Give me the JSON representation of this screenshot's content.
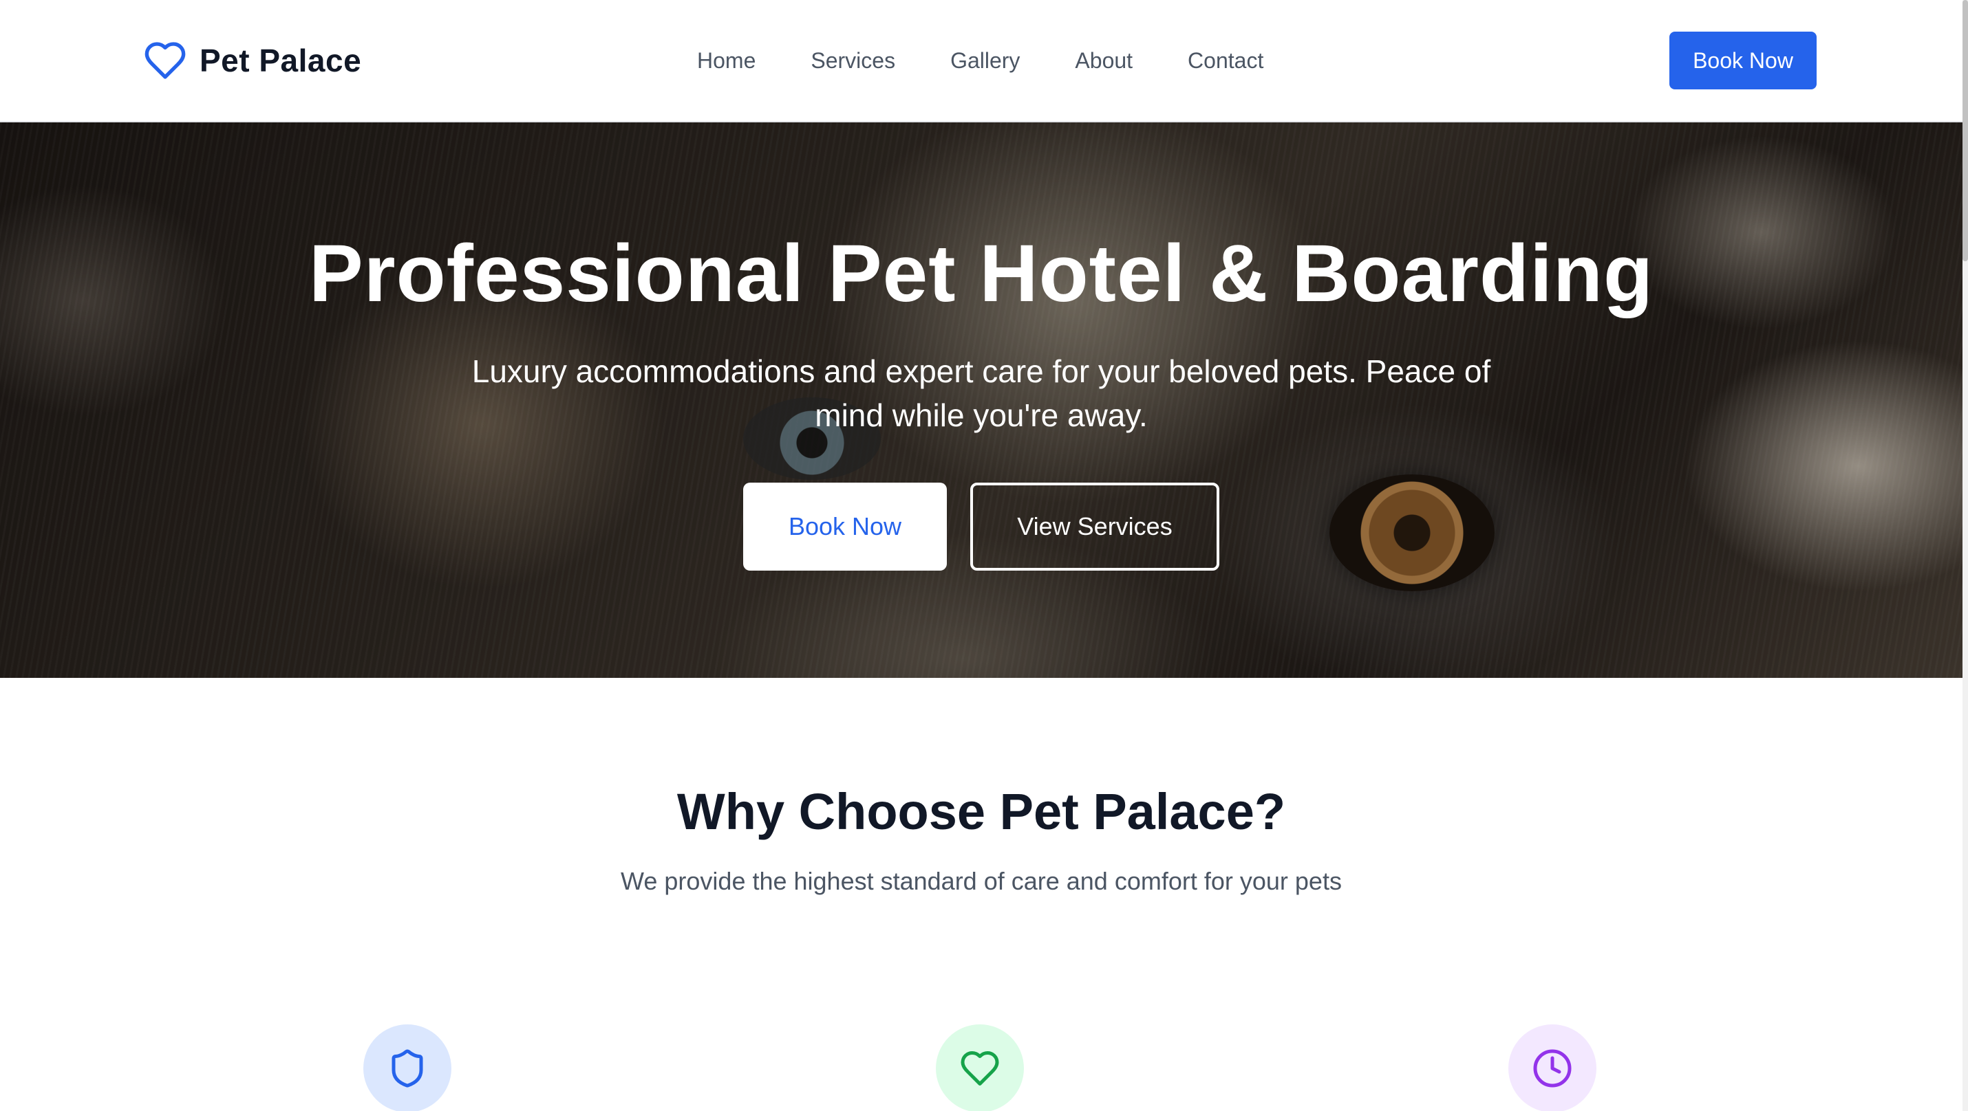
{
  "header": {
    "brand": "Pet Palace",
    "brand_icon": "heart-icon",
    "nav": [
      "Home",
      "Services",
      "Gallery",
      "About",
      "Contact"
    ],
    "cta_label": "Book Now"
  },
  "hero": {
    "title": "Professional Pet Hotel & Boarding",
    "subtitle": "Luxury accommodations and expert care for your beloved pets. Peace of mind while you're away.",
    "primary_label": "Book Now",
    "secondary_label": "View Services",
    "background": "dog-closeup-photo"
  },
  "features": {
    "title": "Why Choose Pet Palace?",
    "subtitle": "We provide the highest standard of care and comfort for your pets",
    "icons": [
      "shield-icon",
      "heart-icon",
      "clock-icon"
    ]
  },
  "colors": {
    "accent": "#2563eb",
    "heading": "#111827",
    "body_text": "#4b5563",
    "icon_blue_bg": "#dbe7fe",
    "icon_green": "#16a34a",
    "icon_green_bg": "#dcfce7",
    "icon_purple": "#9333ea",
    "icon_purple_bg": "#f3e8ff"
  }
}
